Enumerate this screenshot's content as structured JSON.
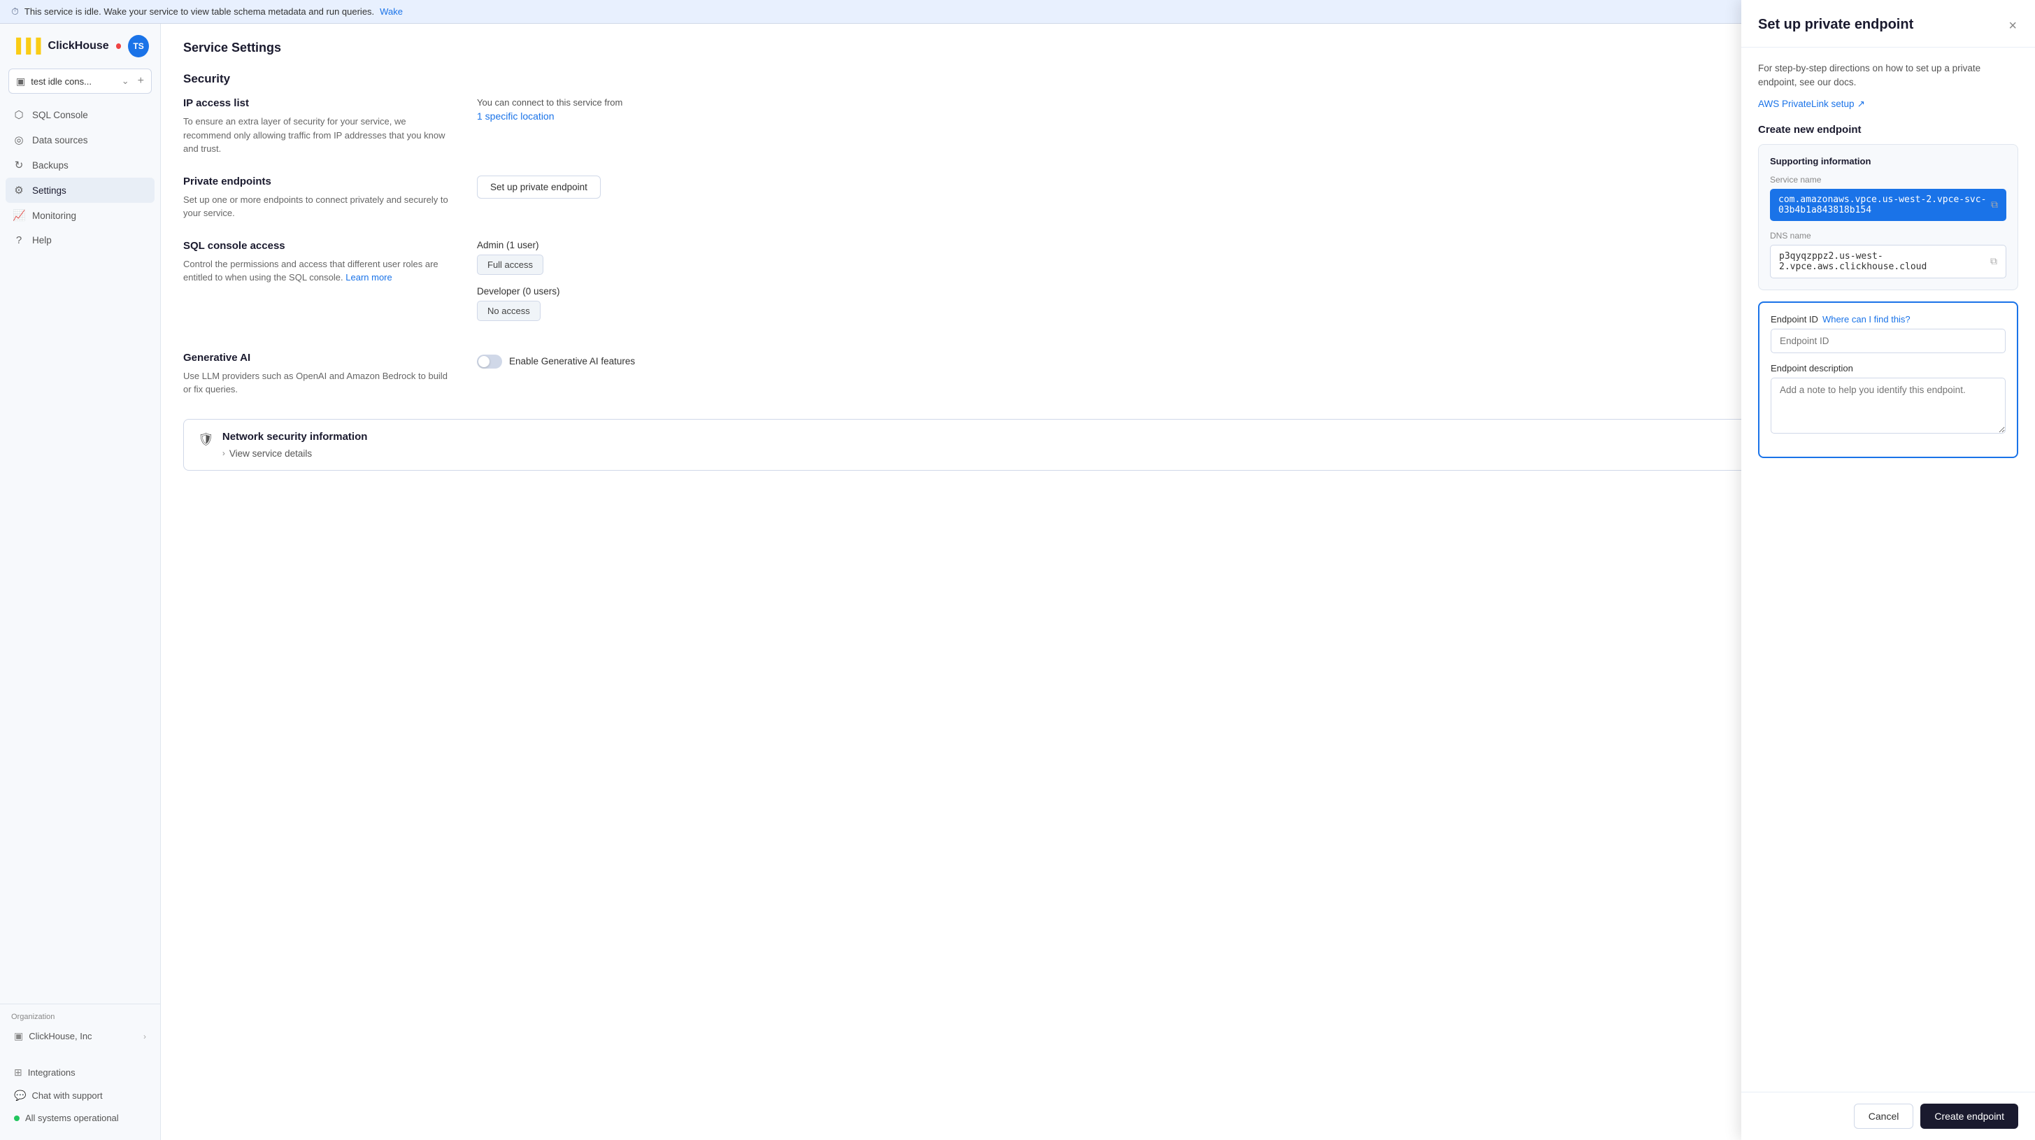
{
  "banner": {
    "text": "This service is idle. Wake your service to view table schema metadata and run queries.",
    "wake_link": "Wake",
    "icon": "⏱"
  },
  "sidebar": {
    "app_name": "ClickHouse",
    "avatar_initials": "TS",
    "service_name": "test idle cons...",
    "nav_items": [
      {
        "id": "sql-console",
        "label": "SQL Console",
        "icon": "⬡"
      },
      {
        "id": "data-sources",
        "label": "Data sources",
        "icon": "◎"
      },
      {
        "id": "backups",
        "label": "Backups",
        "icon": "↻"
      },
      {
        "id": "settings",
        "label": "Settings",
        "icon": "⚙",
        "active": true
      },
      {
        "id": "monitoring",
        "label": "Monitoring",
        "icon": "📊"
      },
      {
        "id": "help",
        "label": "Help",
        "icon": "?"
      }
    ],
    "org_label": "Organization",
    "org_name": "ClickHouse, Inc",
    "bottom_items": [
      {
        "id": "integrations",
        "label": "Integrations",
        "icon": "⊞"
      },
      {
        "id": "chat-support",
        "label": "Chat with support",
        "icon": "💬"
      }
    ],
    "status_text": "All systems operational"
  },
  "main": {
    "page_title": "Service Settings",
    "section_title": "Security",
    "ip_access": {
      "title": "IP access list",
      "description": "To ensure an extra layer of security for your service, we recommend only allowing traffic from IP addresses that you know and trust.",
      "value_subtitle": "You can connect to this service from",
      "value_link": "1 specific location"
    },
    "private_endpoints": {
      "title": "Private endpoints",
      "description": "Set up one or more endpoints to connect privately and securely to your service.",
      "button_label": "Set up private endpoint"
    },
    "sql_console_access": {
      "title": "SQL console access",
      "description": "Control the permissions and access that different user roles are entitled to when using the SQL console.",
      "learn_more": "Learn more",
      "admin_role": "Admin (1 user)",
      "admin_access": "Full access",
      "developer_role": "Developer (0 users)",
      "developer_access": "No access"
    },
    "generative_ai": {
      "title": "Generative AI",
      "description": "Use LLM providers such as OpenAI and Amazon Bedrock to build or fix queries.",
      "toggle_label": "Enable Generative AI features"
    },
    "network_security": {
      "title": "Network security information",
      "view_details": "View service details"
    }
  },
  "panel": {
    "title": "Set up private endpoint",
    "close_label": "×",
    "description": "For step-by-step directions on how to set up a private endpoint, see our docs.",
    "docs_link": "AWS PrivateLink setup",
    "docs_icon": "↗",
    "create_section_title": "Create new endpoint",
    "supporting_info": {
      "card_title": "Supporting information",
      "service_name_label": "Service name",
      "service_name_value": "com.amazonaws.vpce.us-west-2.vpce-svc-03b4b1a843818b154",
      "dns_name_label": "DNS name",
      "dns_name_value": "p3qyqzppz2.us-west-2.vpce.aws.clickhouse.cloud"
    },
    "endpoint_form": {
      "endpoint_id_label": "Endpoint ID",
      "where_find": "Where can I find this?",
      "endpoint_id_placeholder": "Endpoint ID",
      "endpoint_desc_label": "Endpoint description",
      "endpoint_desc_placeholder": "Add a note to help you identify this endpoint."
    },
    "cancel_label": "Cancel",
    "create_label": "Create endpoint"
  }
}
